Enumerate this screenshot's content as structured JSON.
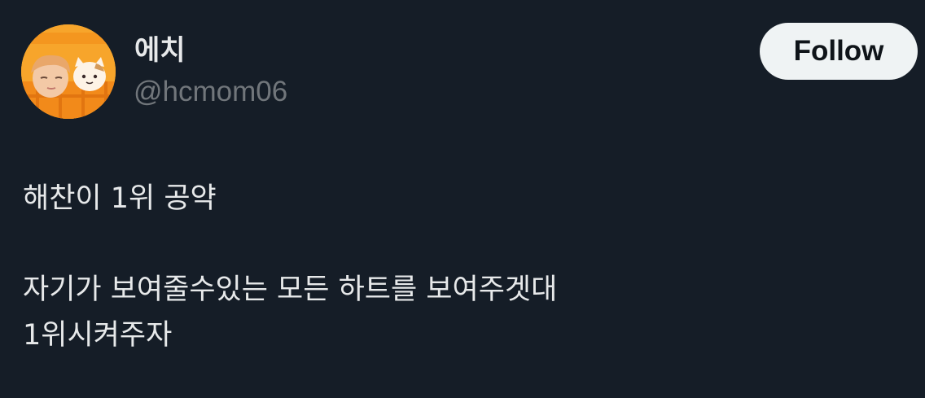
{
  "author": {
    "display_name": "에치",
    "handle": "@hcmom06",
    "avatar_icon": "profile-avatar"
  },
  "actions": {
    "follow_label": "Follow"
  },
  "tweet": {
    "line1": "해찬이 1위 공약",
    "line2": "자기가 보여줄수있는 모든 하트를 보여주겟대\n1위시켜주자"
  },
  "colors": {
    "background": "#151d27",
    "text": "#e7e9ea",
    "handle": "#71767b",
    "follow_bg": "#eff3f4",
    "follow_text": "#0f1419",
    "avatar_orange": "#f6a428"
  }
}
